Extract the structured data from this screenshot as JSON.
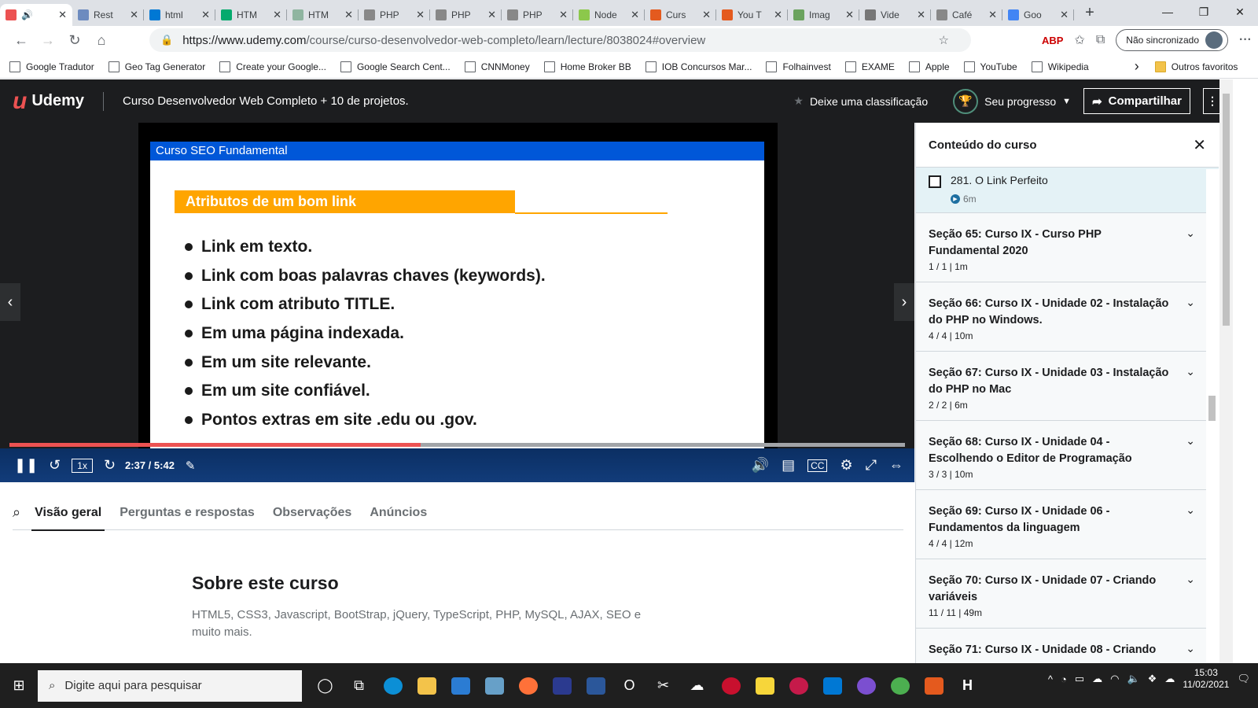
{
  "browser": {
    "tabs": [
      {
        "title": "",
        "icon": "udemy-icon",
        "color": "#ec5252",
        "active": true
      },
      {
        "title": "Rest",
        "icon": "api-icon",
        "color": "#6d8bbf"
      },
      {
        "title": "html",
        "icon": "bing-icon",
        "color": "#0078d4"
      },
      {
        "title": "HTM",
        "icon": "w3-icon",
        "color": "#04aa6d"
      },
      {
        "title": "HTM",
        "icon": "w3-icon",
        "color": "#8fb5a0"
      },
      {
        "title": "PHP",
        "icon": "php-icon",
        "color": "#888888"
      },
      {
        "title": "PHP",
        "icon": "document-icon",
        "color": "#888888"
      },
      {
        "title": "PHP",
        "icon": "php-icon",
        "color": "#888888"
      },
      {
        "title": "Node",
        "icon": "node-icon",
        "color": "#8cc84b"
      },
      {
        "title": "Curs",
        "icon": "course-icon",
        "color": "#e45a1e"
      },
      {
        "title": "You T",
        "icon": "course-icon",
        "color": "#e45a1e"
      },
      {
        "title": "Imag",
        "icon": "image-icon",
        "color": "#6ba35e"
      },
      {
        "title": "Vide",
        "icon": "code-icon",
        "color": "#777777"
      },
      {
        "title": "Café",
        "icon": "document-icon",
        "color": "#888888"
      },
      {
        "title": "Goo",
        "icon": "google-icon",
        "color": "#4285f4"
      }
    ],
    "url_host": "https://www.udemy.com",
    "url_path": "/course/curso-desenvolvedor-web-completo/learn/lecture/8038024#overview",
    "sync_label": "Não sincronizado",
    "bookmarks": [
      "Google Tradutor",
      "Geo Tag Generator",
      "Create your Google...",
      "Google Search Cent...",
      "CNNMoney",
      "Home Broker BB",
      "IOB Concursos Mar...",
      "Folhainvest",
      "EXAME",
      "Apple",
      "YouTube",
      "Wikipedia"
    ],
    "other_favorites": "Outros favoritos"
  },
  "header": {
    "logo": "Udemy",
    "course_title": "Curso Desenvolvedor Web Completo + 10 de projetos.",
    "rate_label": "Deixe uma classificação",
    "progress_label": "Seu progresso",
    "share_label": "Compartilhar"
  },
  "slide": {
    "bar_title": "Curso SEO Fundamental",
    "heading": "Atributos de um bom link",
    "bullets": [
      "Link em texto.",
      "Link com boas palavras chaves (keywords).",
      "Link com atributo TITLE.",
      "Em uma página indexada.",
      "Em um site relevante.",
      "Em um site confiável.",
      "Pontos extras em site .edu ou .gov."
    ]
  },
  "player": {
    "speed": "1x",
    "time": "2:37 / 5:42",
    "progress_fraction": 0.459
  },
  "tabs": [
    "Visão geral",
    "Perguntas e respostas",
    "Observações",
    "Anúncios"
  ],
  "about": {
    "title": "Sobre este curso",
    "text": "HTML5, CSS3, Javascript, BootStrap, jQuery, TypeScript, PHP, MySQL, AJAX, SEO e muito mais."
  },
  "sidebar": {
    "title": "Conteúdo do curso",
    "lecture": {
      "title": "281. O Link Perfeito",
      "duration": "6m"
    },
    "sections": [
      {
        "title": "Seção 65: Curso IX - Curso PHP Fundamental 2020",
        "meta": "1 / 1 | 1m"
      },
      {
        "title": "Seção 66: Curso IX - Unidade 02 - Instalação do PHP no Windows.",
        "meta": "4 / 4 | 10m"
      },
      {
        "title": "Seção 67: Curso IX - Unidade 03 - Instalação do PHP no Mac",
        "meta": "2 / 2 | 6m"
      },
      {
        "title": "Seção 68: Curso IX - Unidade 04 - Escolhendo o Editor de Programação",
        "meta": "3 / 3 | 10m"
      },
      {
        "title": "Seção 69: Curso IX - Unidade 06 - Fundamentos da linguagem",
        "meta": "4 / 4 | 12m"
      },
      {
        "title": "Seção 70: Curso IX - Unidade 07 - Criando variáveis",
        "meta": "11 / 11 | 49m"
      },
      {
        "title": "Seção 71: Curso IX - Unidade 08 - Criando",
        "meta": ""
      }
    ]
  },
  "taskbar": {
    "search_placeholder": "Digite aqui para pesquisar",
    "time": "15:03",
    "date": "11/02/2021"
  }
}
